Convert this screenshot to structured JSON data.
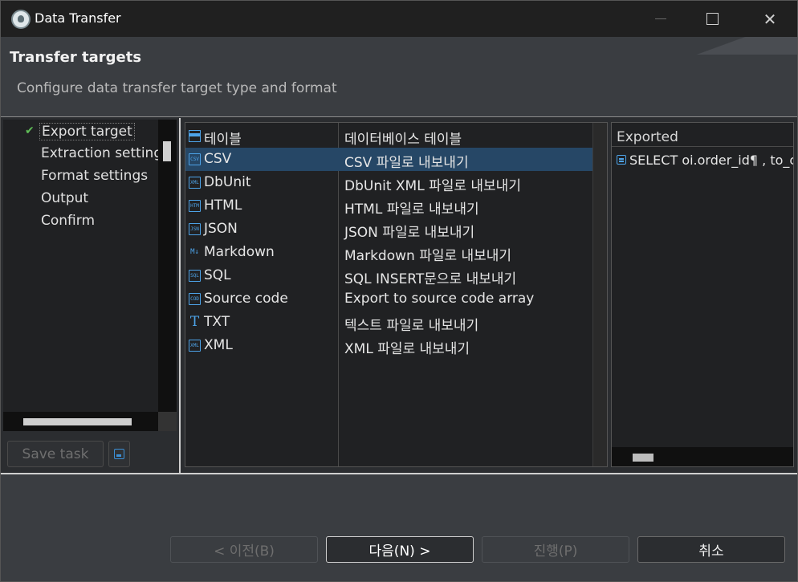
{
  "window": {
    "title": "Data Transfer"
  },
  "header": {
    "title": "Transfer targets",
    "description": "Configure data transfer target type and format"
  },
  "nav": {
    "items": [
      {
        "label": "Export target",
        "checked": true
      },
      {
        "label": "Extraction settings"
      },
      {
        "label": "Format settings"
      },
      {
        "label": "Output"
      },
      {
        "label": "Confirm"
      }
    ]
  },
  "task": {
    "save_label": "Save task"
  },
  "targets": {
    "rows": [
      {
        "icon": "table-icon",
        "name": "테이블",
        "desc": "데이터베이스 테이블"
      },
      {
        "icon": "csv-icon",
        "name": "CSV",
        "desc": "CSV 파일로 내보내기",
        "selected": true
      },
      {
        "icon": "xml-icon",
        "name": "DbUnit",
        "desc": "DbUnit XML 파일로 내보내기"
      },
      {
        "icon": "html-icon",
        "name": "HTML",
        "desc": "HTML 파일로 내보내기"
      },
      {
        "icon": "json-icon",
        "name": "JSON",
        "desc": "JSON 파일로 내보내기"
      },
      {
        "icon": "markdown-icon",
        "name": "Markdown",
        "desc": "Markdown 파일로 내보내기"
      },
      {
        "icon": "sql-icon",
        "name": "SQL",
        "desc": "SQL INSERT문으로 내보내기"
      },
      {
        "icon": "code-icon",
        "name": "Source code",
        "desc": "Export to source code array"
      },
      {
        "icon": "text-icon",
        "name": "TXT",
        "desc": "텍스트 파일로 내보내기"
      },
      {
        "icon": "xml-icon",
        "name": "XML",
        "desc": "XML 파일로 내보내기"
      }
    ]
  },
  "exported": {
    "header": "Exported",
    "query": "SELECT oi.order_id¶ , to_c"
  },
  "footer": {
    "back": "< 이전(B)",
    "next": "다음(N) >",
    "proceed": "진행(P)",
    "cancel": "취소"
  },
  "colors": {
    "selection": "#264766",
    "check": "#5fbd57",
    "icon_blue": "#4da3e8"
  }
}
